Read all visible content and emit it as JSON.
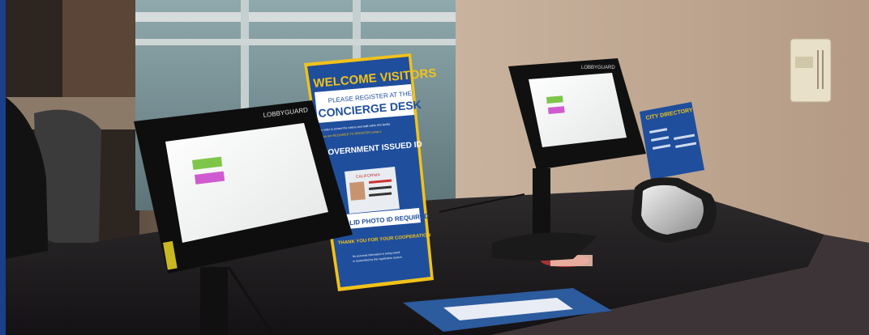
{
  "scene": {
    "left_tablet": {
      "brand": "LOBBYGUARD"
    },
    "right_tablet": {
      "brand": "LOBBYGUARD"
    },
    "sign": {
      "title": "WELCOME VISITORS",
      "line1": "PLEASE REGISTER AT THE",
      "line2": "CONCIERGE DESK",
      "small1": "In order to protect the visitors and staff within this facility",
      "small2": "you are REQUIRED TO REGISTER using a",
      "line3": "GOVERNMENT ISSUED ID",
      "id_card": "CALIFORNIA",
      "banner": "VALID PHOTO ID REQUIRED",
      "thanks": "THANK YOU FOR YOUR COOPERATION",
      "fine1": "No personal information is being saved",
      "fine2": "or transmitted by this registration system."
    },
    "directory": {
      "title": "CITY DIRECTORY"
    }
  },
  "colors": {
    "accent": "#1c3f8c",
    "sign_blue": "#1f4e9c",
    "sign_yellow": "#f2c21a"
  }
}
